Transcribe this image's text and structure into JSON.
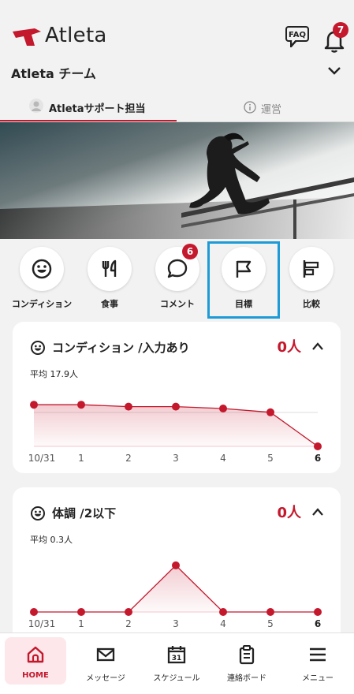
{
  "app": {
    "logo_text": "Atleta",
    "faq_label": "FAQ",
    "notification_count": "7",
    "team_name": "Atleta チーム"
  },
  "tabs": [
    {
      "label": "Atletaサポート担当",
      "active": true
    },
    {
      "label": "運営",
      "active": false
    }
  ],
  "quick_actions": [
    {
      "label": "コンディション",
      "icon": "smiley-icon"
    },
    {
      "label": "食事",
      "icon": "fork-knife-icon"
    },
    {
      "label": "コメント",
      "icon": "chat-bubble-icon",
      "badge": "6"
    },
    {
      "label": "目標",
      "icon": "flag-icon",
      "highlighted": true
    },
    {
      "label": "比較",
      "icon": "bar-compare-icon"
    }
  ],
  "cards": [
    {
      "title": "コンディション /入力あり",
      "value": "0人",
      "average": "平均 17.9人"
    },
    {
      "title": "体調 /2以下",
      "value": "0人",
      "average": "平均 0.3人"
    }
  ],
  "chart_data": [
    {
      "type": "area",
      "title": "コンディション /入力あり",
      "categories": [
        "10/31",
        "1",
        "2",
        "3",
        "4",
        "5",
        "6"
      ],
      "values": [
        22,
        22,
        21,
        21,
        20,
        18,
        0
      ],
      "average": 17.9,
      "ylim": [
        0,
        25
      ]
    },
    {
      "type": "area",
      "title": "体調 /2以下",
      "categories": [
        "10/31",
        "1",
        "2",
        "3",
        "4",
        "5",
        "6"
      ],
      "values": [
        0,
        0,
        0,
        2,
        0,
        0,
        0
      ],
      "average": 0.3,
      "ylim": [
        0,
        2.2
      ]
    }
  ],
  "nav": [
    {
      "label": "HOME",
      "icon": "home-icon",
      "active": true
    },
    {
      "label": "メッセージ",
      "icon": "mail-icon"
    },
    {
      "label": "スケジュール",
      "icon": "calendar-icon",
      "icon_text": "31"
    },
    {
      "label": "連絡ボード",
      "icon": "clipboard-icon"
    },
    {
      "label": "メニュー",
      "icon": "hamburger-icon"
    }
  ],
  "colors": {
    "accent": "#c4182d",
    "highlight": "#1e9bd7",
    "background": "#f2f2f2"
  }
}
